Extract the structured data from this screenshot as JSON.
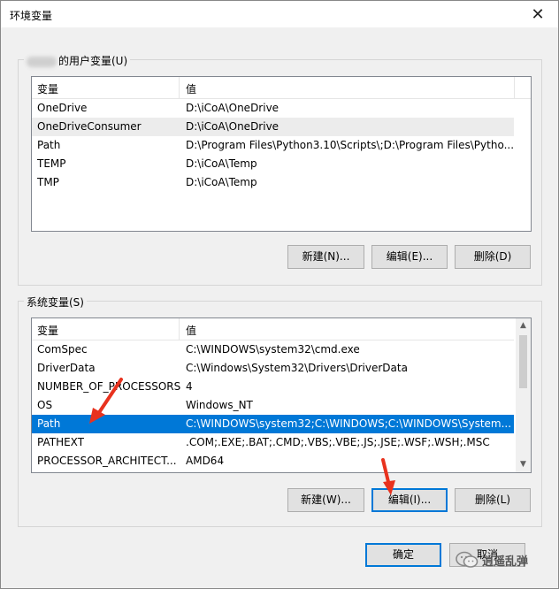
{
  "window": {
    "title": "环境变量"
  },
  "user_group": {
    "legend": "的用户变量(U)",
    "headers": [
      "变量",
      "值"
    ],
    "rows": [
      [
        "OneDrive",
        "D:\\iCoA\\OneDrive"
      ],
      [
        "OneDriveConsumer",
        "D:\\iCoA\\OneDrive"
      ],
      [
        "Path",
        "D:\\Program Files\\Python3.10\\Scripts\\;D:\\Program Files\\Pytho..."
      ],
      [
        "TEMP",
        "D:\\iCoA\\Temp"
      ],
      [
        "TMP",
        "D:\\iCoA\\Temp"
      ]
    ],
    "buttons": {
      "new": "新建(N)...",
      "edit": "编辑(E)...",
      "delete": "删除(D)"
    }
  },
  "system_group": {
    "legend": "系统变量(S)",
    "headers": [
      "变量",
      "值"
    ],
    "rows": [
      [
        "ComSpec",
        "C:\\WINDOWS\\system32\\cmd.exe"
      ],
      [
        "DriverData",
        "C:\\Windows\\System32\\Drivers\\DriverData"
      ],
      [
        "NUMBER_OF_PROCESSORS",
        "4"
      ],
      [
        "OS",
        "Windows_NT"
      ],
      [
        "Path",
        "C:\\WINDOWS\\system32;C:\\WINDOWS;C:\\WINDOWS\\System..."
      ],
      [
        "PATHEXT",
        ".COM;.EXE;.BAT;.CMD;.VBS;.VBE;.JS;.JSE;.WSF;.WSH;.MSC"
      ],
      [
        "PROCESSOR_ARCHITECT...",
        "AMD64"
      ]
    ],
    "selected_row": "Path",
    "buttons": {
      "new": "新建(W)...",
      "edit": "编辑(I)...",
      "delete": "删除(L)"
    }
  },
  "footer": {
    "ok": "确定",
    "cancel": "取消"
  },
  "watermark": {
    "text": "逍遥乱弹"
  },
  "colors": {
    "selection": "#0078d7",
    "annotation_arrow": "#e8321e"
  },
  "icons": {
    "close": "close-icon",
    "scroll_up": "chevron-up-icon",
    "scroll_down": "chevron-down-icon",
    "watermark": "wechat-icon"
  }
}
